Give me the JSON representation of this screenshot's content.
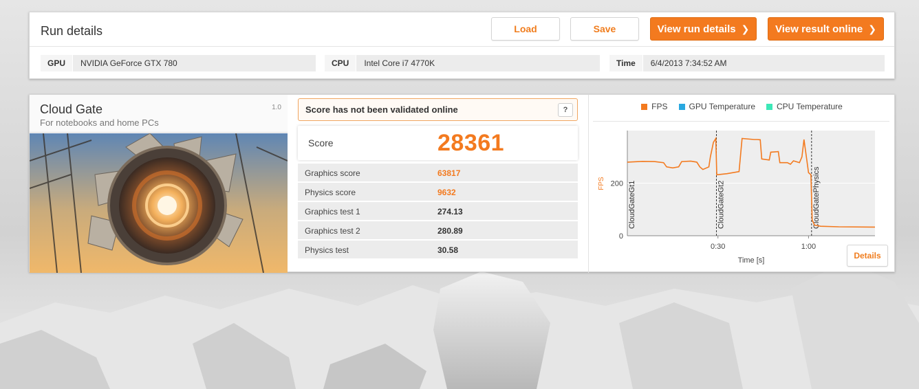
{
  "header": {
    "title": "Run details",
    "load_label": "Load",
    "save_label": "Save",
    "view_run_details_label": "View run details",
    "view_result_online_label": "View result online"
  },
  "system": {
    "gpu_label": "GPU",
    "gpu_value": "NVIDIA GeForce GTX 780",
    "cpu_label": "CPU",
    "cpu_value": "Intel Core i7 4770K",
    "time_label": "Time",
    "time_value": "6/4/2013 7:34:52 AM"
  },
  "test": {
    "name": "Cloud Gate",
    "subtitle": "For notebooks and home PCs",
    "version": "1.0"
  },
  "validation": {
    "message": "Score has not been validated online",
    "help_label": "?"
  },
  "score": {
    "label": "Score",
    "value": "28361"
  },
  "results": [
    {
      "label": "Graphics score",
      "value": "63817",
      "highlight": true
    },
    {
      "label": "Physics score",
      "value": "9632",
      "highlight": true
    },
    {
      "label": "Graphics test 1",
      "value": "274.13",
      "highlight": false
    },
    {
      "label": "Graphics test 2",
      "value": "280.89",
      "highlight": false
    },
    {
      "label": "Physics test",
      "value": "30.58",
      "highlight": false
    }
  ],
  "chart": {
    "details_label": "Details"
  },
  "colors": {
    "accent": "#f37a1f",
    "fps": "#f37a1f",
    "gpu_temp": "#29a8e0",
    "cpu_temp": "#3de8b8"
  },
  "chart_data": {
    "type": "line",
    "title": "",
    "xlabel": "Time [s]",
    "ylabel": "FPS",
    "x_ticks": [
      "0:30",
      "1:00"
    ],
    "y_ticks": [
      0,
      200
    ],
    "xlim": [
      0,
      82
    ],
    "ylim": [
      0,
      400
    ],
    "grid": true,
    "legend_position": "top",
    "legend": [
      "FPS",
      "GPU Temperature",
      "CPU Temperature"
    ],
    "markers": [
      {
        "label": "CloudGateGt1",
        "x": 0
      },
      {
        "label": "CloudGateGt2",
        "x": 29.5
      },
      {
        "label": "CloudGatePhysics",
        "x": 61
      }
    ],
    "series": [
      {
        "name": "FPS",
        "points": [
          [
            0,
            280
          ],
          [
            5,
            283
          ],
          [
            9,
            282
          ],
          [
            12,
            278
          ],
          [
            13,
            262
          ],
          [
            15,
            258
          ],
          [
            17,
            262
          ],
          [
            18,
            282
          ],
          [
            21,
            284
          ],
          [
            23,
            280
          ],
          [
            24,
            262
          ],
          [
            25,
            252
          ],
          [
            27,
            262
          ],
          [
            27.5,
            300
          ],
          [
            28.5,
            355
          ],
          [
            29.3,
            370
          ],
          [
            29.6,
            232
          ],
          [
            33,
            236
          ],
          [
            37,
            244
          ],
          [
            38,
            370
          ],
          [
            42,
            366
          ],
          [
            43,
            366
          ],
          [
            44,
            365
          ],
          [
            44.5,
            292
          ],
          [
            47,
            288
          ],
          [
            47.5,
            318
          ],
          [
            50,
            320
          ],
          [
            50.5,
            278
          ],
          [
            53,
            278
          ],
          [
            54,
            272
          ],
          [
            55,
            285
          ],
          [
            57,
            278
          ],
          [
            57.8,
            300
          ],
          [
            58.5,
            366
          ],
          [
            59.4,
            290
          ],
          [
            60,
            240
          ],
          [
            60.8,
            232
          ],
          [
            61.2,
            60
          ],
          [
            62,
            40
          ],
          [
            64,
            36
          ],
          [
            70,
            34
          ],
          [
            82,
            33
          ]
        ]
      }
    ]
  }
}
